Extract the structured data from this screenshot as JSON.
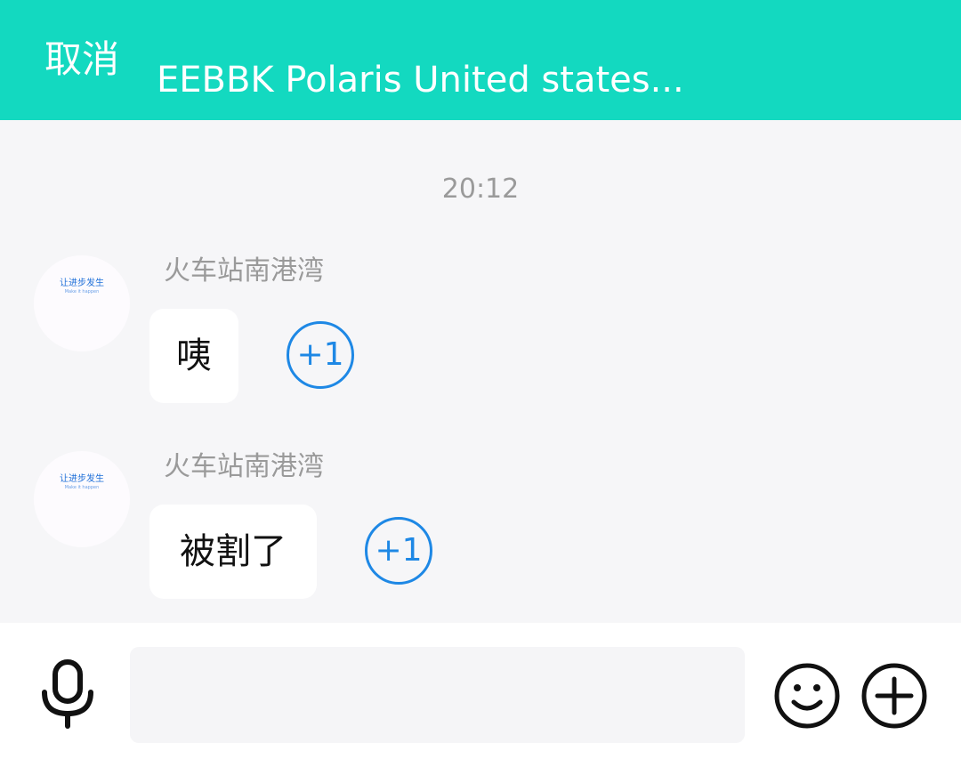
{
  "header": {
    "cancel_label": "取消",
    "title": "EEBBK Polaris United states..."
  },
  "chat": {
    "timestamp": "20:12",
    "messages": [
      {
        "sender": "火车站南港湾",
        "text": "咦",
        "avatar_logo": "让进步发生",
        "avatar_tagline": "Make it happen",
        "plus_one": "+1"
      },
      {
        "sender": "火车站南港湾",
        "text": "被割了",
        "avatar_logo": "让进步发生",
        "avatar_tagline": "Make it happen",
        "plus_one": "+1"
      }
    ]
  },
  "composer": {
    "input_value": "",
    "input_placeholder": "",
    "icons": [
      "microphone-icon",
      "emoji-icon",
      "plus-icon"
    ]
  },
  "colors": {
    "header_bg": "#13d9c0",
    "chat_bg": "#f6f6f8",
    "accent_blue": "#1e88e5"
  }
}
